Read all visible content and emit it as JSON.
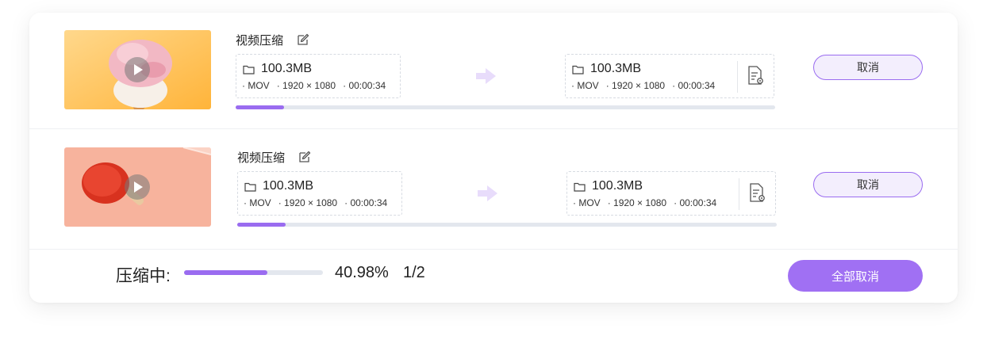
{
  "colors": {
    "accent": "#9a6cf0",
    "accent_light": "#f3eefd",
    "track": "#e3e7ee"
  },
  "tasks": [
    {
      "title": "视频压缩",
      "source": {
        "size": "100.3MB",
        "format": "MOV",
        "resolution": "1920 × 1080",
        "duration": "00:00:34"
      },
      "output": {
        "size": "100.3MB",
        "format": "MOV",
        "resolution": "1920 × 1080",
        "duration": "00:00:34"
      },
      "progress": 0.09,
      "cancel_label": "取消",
      "thumbnail": "ice-cream"
    },
    {
      "title": "视频压缩",
      "source": {
        "size": "100.3MB",
        "format": "MOV",
        "resolution": "1920 × 1080",
        "duration": "00:00:34"
      },
      "output": {
        "size": "100.3MB",
        "format": "MOV",
        "resolution": "1920 × 1080",
        "duration": "00:00:34"
      },
      "progress": 0.09,
      "cancel_label": "取消",
      "thumbnail": "ping-pong-paddle"
    }
  ],
  "footer": {
    "label": "压缩中:",
    "percent": "40.98%",
    "count": "1/2",
    "progress": 0.6,
    "cancel_all_label": "全部取消"
  },
  "icons": [
    "play-icon",
    "edit-icon",
    "folder-icon",
    "arrow-right-icon",
    "file-settings-icon"
  ]
}
